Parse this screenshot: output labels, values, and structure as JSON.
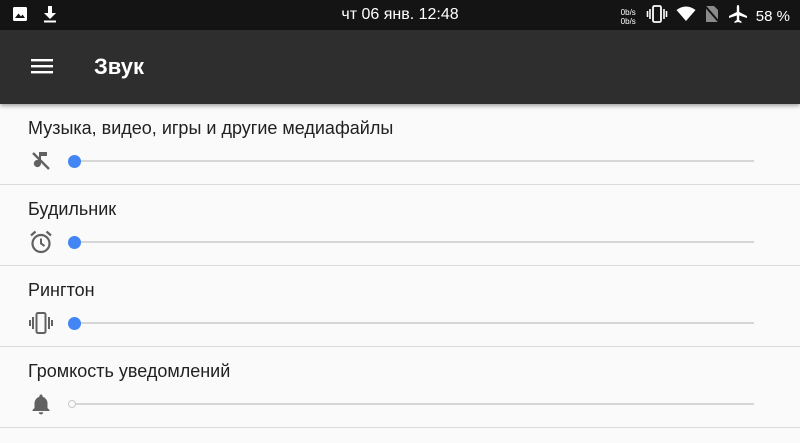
{
  "status_bar": {
    "clock": "чт 06 янв. 12:48",
    "net_up": "0b/s",
    "net_down": "0b/s",
    "battery": "58 %",
    "icons": [
      "image-icon",
      "download-icon",
      "vibrate-icon",
      "wifi-icon",
      "no-sim-icon",
      "airplane-icon"
    ]
  },
  "app_bar": {
    "title": "Звук",
    "menu_icon": "menu-icon"
  },
  "volumes": [
    {
      "label": "Музыка, видео, игры и другие медиафайлы",
      "icon": "music-off-icon",
      "level": 0,
      "enabled": true
    },
    {
      "label": "Будильник",
      "icon": "alarm-icon",
      "level": 0,
      "enabled": true
    },
    {
      "label": "Рингтон",
      "icon": "vibrate-icon",
      "level": 0,
      "enabled": true
    },
    {
      "label": "Громкость уведомлений",
      "icon": "bell-icon",
      "level": 0,
      "enabled": false
    }
  ],
  "colors": {
    "accent": "#4285f4",
    "app_bar": "#2e2e2e",
    "status_bar": "#141414",
    "background": "#fafafa"
  }
}
